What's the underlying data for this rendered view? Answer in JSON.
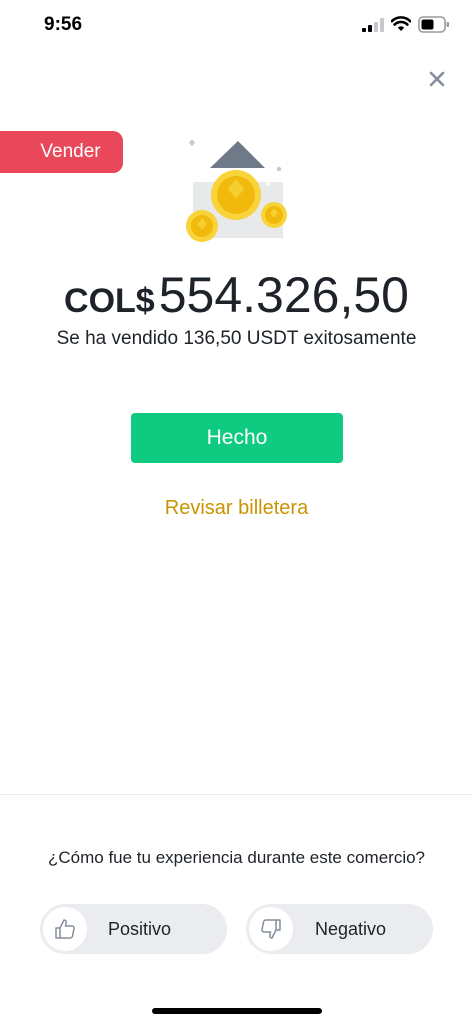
{
  "status_bar": {
    "time": "9:56"
  },
  "badge": {
    "label": "Vender",
    "color": "#e84859"
  },
  "amount": {
    "currency": "COL$",
    "value": "554.326,50"
  },
  "message": "Se ha vendido 136,50 USDT exitosamente",
  "actions": {
    "done_label": "Hecho",
    "wallet_link": "Revisar billetera"
  },
  "feedback": {
    "question": "¿Cómo fue tu experiencia durante este comercio?",
    "positive_label": "Positivo",
    "negative_label": "Negativo"
  },
  "colors": {
    "accent_green": "#0ecb81",
    "link_gold": "#c99400",
    "text_dark": "#1e2329"
  }
}
